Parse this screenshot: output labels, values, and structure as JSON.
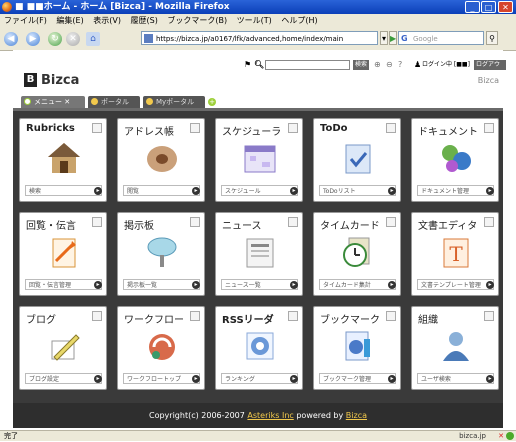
{
  "window": {
    "title": "■ ■■ホーム - ホーム [Bizca] - Mozilla Firefox"
  },
  "menu": [
    "ファイル(F)",
    "編集(E)",
    "表示(V)",
    "履歴(S)",
    "ブックマーク(B)",
    "ツール(T)",
    "ヘルプ(H)"
  ],
  "toolbar": {
    "url": "https://bizca.jp/a0167/lfk/advanced,home/index/main",
    "search_placeholder": "Google"
  },
  "app": {
    "logo_letter": "B",
    "name": "Bizca",
    "brand_small": "Bizca",
    "user_label": "ログイン中 [■■]",
    "logout": "ログアウト",
    "go": "検索"
  },
  "tabs": [
    {
      "label": "メニュー ✕"
    },
    {
      "label": "ポータル"
    },
    {
      "label": "Myポータル"
    }
  ],
  "cards": [
    {
      "title": "Rubricks",
      "sub": "検索",
      "icon": "house-icon",
      "jp": false
    },
    {
      "title": "アドレス帳",
      "sub": "閲覧",
      "icon": "address-book-icon",
      "jp": true
    },
    {
      "title": "スケジューラ",
      "sub": "スケジュール",
      "icon": "calendar-icon",
      "jp": true
    },
    {
      "title": "ToDo",
      "sub": "ToDoリスト",
      "icon": "todo-check-icon",
      "jp": false
    },
    {
      "title": "ドキュメント",
      "sub": "ドキュメント管理",
      "icon": "document-gears-icon",
      "jp": true
    },
    {
      "title": "回覧・伝言",
      "sub": "回覧・伝言管理",
      "icon": "circulation-icon",
      "jp": true
    },
    {
      "title": "掲示板",
      "sub": "掲示板一覧",
      "icon": "signboard-icon",
      "jp": true
    },
    {
      "title": "ニュース",
      "sub": "ニュース一覧",
      "icon": "news-icon",
      "jp": true
    },
    {
      "title": "タイムカード",
      "sub": "タイムカード集計",
      "icon": "clock-icon",
      "jp": true
    },
    {
      "title": "文書エディタ",
      "sub": "文書テンプレート管理",
      "icon": "text-editor-icon",
      "jp": true
    },
    {
      "title": "ブログ",
      "sub": "ブログ設定",
      "icon": "pencil-icon",
      "jp": true
    },
    {
      "title": "ワークフロー",
      "sub": "ワークフロートップ",
      "icon": "workflow-icon",
      "jp": true
    },
    {
      "title": "RSSリーダ",
      "sub": "ランキング",
      "icon": "rss-icon",
      "jp": false
    },
    {
      "title": "ブックマーク",
      "sub": "ブックマーク管理",
      "icon": "bookmark-icon",
      "jp": true
    },
    {
      "title": "組織",
      "sub": "ユーザ検索",
      "icon": "person-icon",
      "jp": true
    }
  ],
  "footer": {
    "prefix": "Copyright(c) 2006-2007 ",
    "company": "Asteriks Inc",
    "middle": " powered by ",
    "brand": "Bizca"
  },
  "status": {
    "left": "完了",
    "right": "bizca.jp"
  },
  "colors": {
    "accent": "#9ed03a",
    "grid_bg": "#3a3a3a",
    "footer_link": "#f2c94c"
  }
}
